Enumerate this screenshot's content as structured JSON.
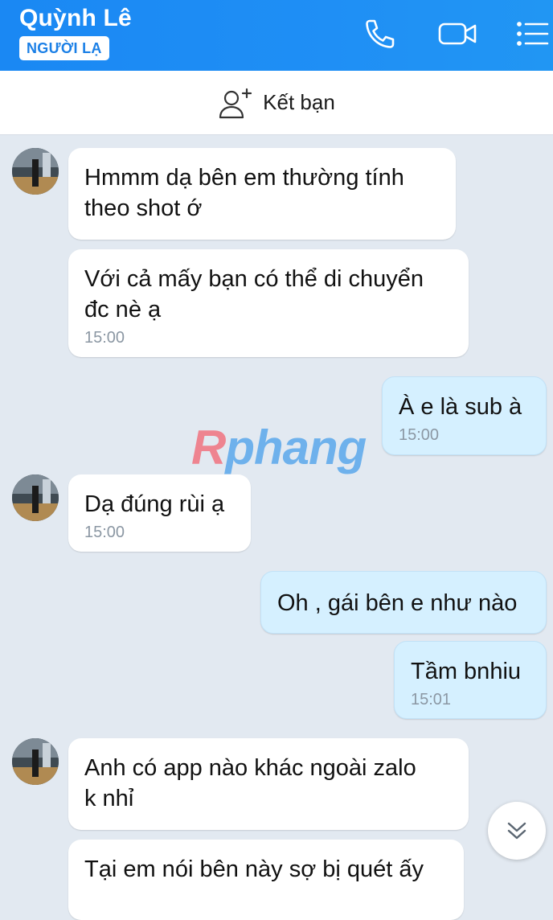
{
  "header": {
    "contact_name": "Quỳnh Lê",
    "badge": "NGƯỜI LẠ",
    "icons": [
      "phone-icon",
      "video-call-icon",
      "menu-icon"
    ]
  },
  "add_friend": {
    "label": "Kết bạn",
    "icon": "add-user-icon"
  },
  "watermark": {
    "part1": "R",
    "part2": "phang"
  },
  "messages": [
    {
      "direction": "incoming",
      "text_lines": [
        "Hmmm dạ bên em thường tính",
        "theo shot ớ"
      ],
      "time": ""
    },
    {
      "direction": "incoming",
      "text_lines": [
        "Với cả mấy bạn có thể di chuyển",
        "đc nè ạ"
      ],
      "time": "15:00"
    },
    {
      "direction": "outgoing",
      "text_lines": [
        "À e là sub à"
      ],
      "time": "15:00"
    },
    {
      "direction": "incoming",
      "text_lines": [
        "Dạ đúng rùi ạ"
      ],
      "time": "15:00"
    },
    {
      "direction": "outgoing",
      "text_lines": [
        "Oh , gái bên e như nào"
      ],
      "time": ""
    },
    {
      "direction": "outgoing",
      "text_lines": [
        "Tầm bnhiu"
      ],
      "time": "15:01"
    },
    {
      "direction": "incoming",
      "text_lines": [
        "Anh có app nào khác ngoài zalo",
        "k nhỉ"
      ],
      "time": ""
    },
    {
      "direction": "incoming",
      "text_lines": [
        "Tại em nói bên này sợ bị quét ấy"
      ],
      "time": ""
    }
  ],
  "colors": {
    "header_bg": "#1a88f3",
    "chat_bg": "#e2e9f1",
    "incoming_bubble": "#ffffff",
    "outgoing_bubble": "#d5f0ff",
    "timestamp": "#8b97a3"
  },
  "scroll_button": {
    "icon": "double-chevron-down-icon"
  }
}
